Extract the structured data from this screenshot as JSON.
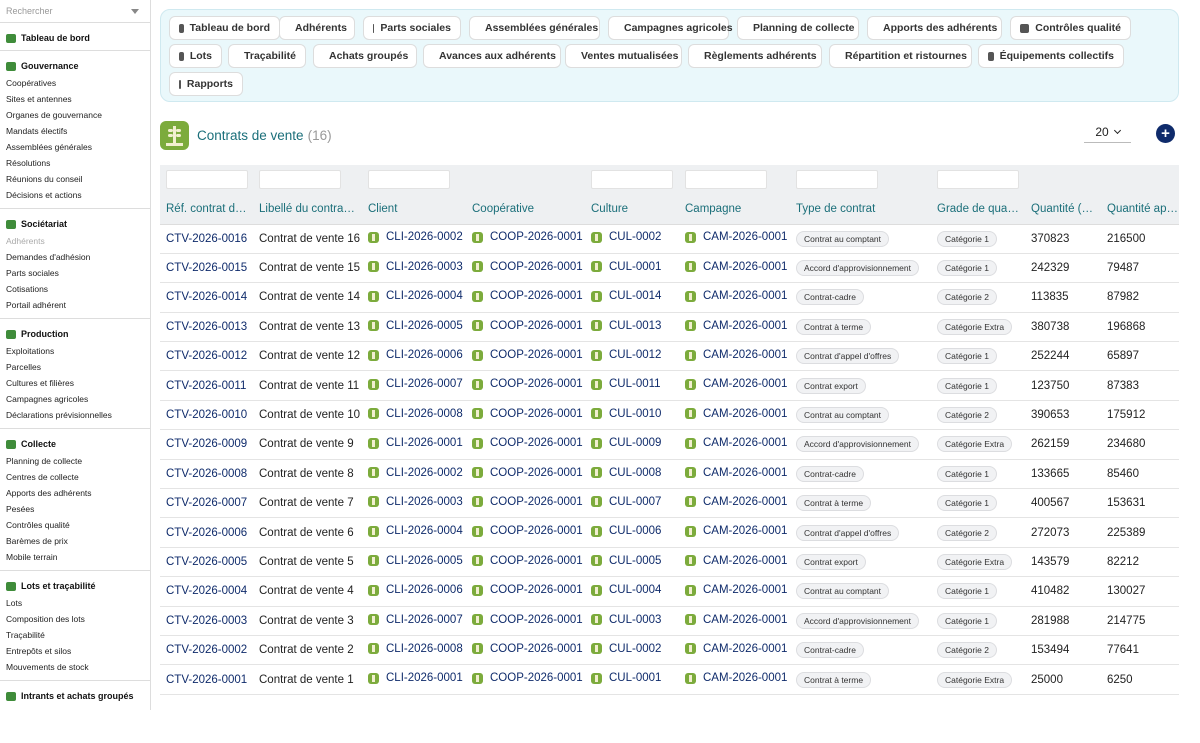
{
  "sidebar": {
    "search_placeholder": "Rechercher",
    "sections": [
      {
        "title": "Tableau de bord",
        "icon": "dashboard-icon",
        "items": []
      },
      {
        "title": "Gouvernance",
        "icon": "institution-icon",
        "items": [
          "Coopératives",
          "Sites et antennes",
          "Organes de gouvernance",
          "Mandats électifs",
          "Assemblées générales",
          "Résolutions",
          "Réunions du conseil",
          "Décisions et actions"
        ]
      },
      {
        "title": "Sociétariat",
        "icon": "users-icon",
        "items": [
          "Adhérents",
          "Demandes d'adhésion",
          "Parts sociales",
          "Cotisations",
          "Portail adhérent"
        ]
      },
      {
        "title": "Production",
        "icon": "tractor-icon",
        "items": [
          "Exploitations",
          "Parcelles",
          "Cultures et filières",
          "Campagnes agricoles",
          "Déclarations prévisionnelles"
        ]
      },
      {
        "title": "Collecte",
        "icon": "truck-icon",
        "items": [
          "Planning de collecte",
          "Centres de collecte",
          "Apports des adhérents",
          "Pesées",
          "Contrôles qualité",
          "Barèmes de prix",
          "Mobile terrain"
        ]
      },
      {
        "title": "Lots et traçabilité",
        "icon": "boxes-icon",
        "items": [
          "Lots",
          "Composition des lots",
          "Traçabilité",
          "Entrepôts et silos",
          "Mouvements de stock"
        ]
      },
      {
        "title": "Intrants et achats groupés",
        "icon": "cart-icon",
        "items": []
      }
    ]
  },
  "topnav": [
    {
      "label": "Tableau de bord",
      "icon": "dashboard-icon"
    },
    {
      "label": "Adhérents",
      "icon": "user-icon"
    },
    {
      "label": "Parts sociales",
      "icon": "ticket-icon"
    },
    {
      "label": "Assemblées générales",
      "icon": "users-icon"
    },
    {
      "label": "Campagnes agricoles",
      "icon": "calendar-icon"
    },
    {
      "label": "Planning de collecte",
      "icon": "route-icon"
    },
    {
      "label": "Apports des adhérents",
      "icon": "truck-icon"
    },
    {
      "label": "Contrôles qualité",
      "icon": "checklist-icon"
    },
    {
      "label": "Lots",
      "icon": "boxes-icon"
    },
    {
      "label": "Traçabilité",
      "icon": "barcode-icon"
    },
    {
      "label": "Achats groupés",
      "icon": "cart-icon"
    },
    {
      "label": "Avances aux adhérents",
      "icon": "seedling-icon"
    },
    {
      "label": "Ventes mutualisées",
      "icon": "dolly-icon"
    },
    {
      "label": "Règlements adhérents",
      "icon": "money-icon"
    },
    {
      "label": "Répartition et ristournes",
      "icon": "scale-icon"
    },
    {
      "label": "Équipements collectifs",
      "icon": "tools-icon"
    },
    {
      "label": "Rapports",
      "icon": "chart-pie-icon"
    }
  ],
  "header": {
    "title": "Contrats de vente",
    "count": "(16)",
    "page_size": "20"
  },
  "table": {
    "columns": [
      "Réf. contrat de vente",
      "Libellé du contrat de vente",
      "Client",
      "Coopérative",
      "Culture",
      "Campagne",
      "Type de contrat",
      "Grade de qualité",
      "Quantité (kg)",
      "Quantité appelée (kg)"
    ],
    "rows": [
      [
        "CTV-2026-0016",
        "Contrat de vente 16",
        "CLI-2026-0002",
        "COOP-2026-0001",
        "CUL-0002",
        "CAM-2026-0001",
        "Contrat au comptant",
        "Catégorie 1",
        "370823",
        "216500"
      ],
      [
        "CTV-2026-0015",
        "Contrat de vente 15",
        "CLI-2026-0003",
        "COOP-2026-0001",
        "CUL-0001",
        "CAM-2026-0001",
        "Accord d'approvisionnement",
        "Catégorie 1",
        "242329",
        "79487"
      ],
      [
        "CTV-2026-0014",
        "Contrat de vente 14",
        "CLI-2026-0004",
        "COOP-2026-0001",
        "CUL-0014",
        "CAM-2026-0001",
        "Contrat-cadre",
        "Catégorie 2",
        "113835",
        "87982"
      ],
      [
        "CTV-2026-0013",
        "Contrat de vente 13",
        "CLI-2026-0005",
        "COOP-2026-0001",
        "CUL-0013",
        "CAM-2026-0001",
        "Contrat à terme",
        "Catégorie Extra",
        "380738",
        "196868"
      ],
      [
        "CTV-2026-0012",
        "Contrat de vente 12",
        "CLI-2026-0006",
        "COOP-2026-0001",
        "CUL-0012",
        "CAM-2026-0001",
        "Contrat d'appel d'offres",
        "Catégorie 1",
        "252244",
        "65897"
      ],
      [
        "CTV-2026-0011",
        "Contrat de vente 11",
        "CLI-2026-0007",
        "COOP-2026-0001",
        "CUL-0011",
        "CAM-2026-0001",
        "Contrat export",
        "Catégorie 1",
        "123750",
        "87383"
      ],
      [
        "CTV-2026-0010",
        "Contrat de vente 10",
        "CLI-2026-0008",
        "COOP-2026-0001",
        "CUL-0010",
        "CAM-2026-0001",
        "Contrat au comptant",
        "Catégorie 2",
        "390653",
        "175912"
      ],
      [
        "CTV-2026-0009",
        "Contrat de vente 9",
        "CLI-2026-0001",
        "COOP-2026-0001",
        "CUL-0009",
        "CAM-2026-0001",
        "Accord d'approvisionnement",
        "Catégorie Extra",
        "262159",
        "234680"
      ],
      [
        "CTV-2026-0008",
        "Contrat de vente 8",
        "CLI-2026-0002",
        "COOP-2026-0001",
        "CUL-0008",
        "CAM-2026-0001",
        "Contrat-cadre",
        "Catégorie 1",
        "133665",
        "85460"
      ],
      [
        "CTV-2026-0007",
        "Contrat de vente 7",
        "CLI-2026-0003",
        "COOP-2026-0001",
        "CUL-0007",
        "CAM-2026-0001",
        "Contrat à terme",
        "Catégorie 1",
        "400567",
        "153631"
      ],
      [
        "CTV-2026-0006",
        "Contrat de vente 6",
        "CLI-2026-0004",
        "COOP-2026-0001",
        "CUL-0006",
        "CAM-2026-0001",
        "Contrat d'appel d'offres",
        "Catégorie 2",
        "272073",
        "225389"
      ],
      [
        "CTV-2026-0005",
        "Contrat de vente 5",
        "CLI-2026-0005",
        "COOP-2026-0001",
        "CUL-0005",
        "CAM-2026-0001",
        "Contrat export",
        "Catégorie Extra",
        "143579",
        "82212"
      ],
      [
        "CTV-2026-0004",
        "Contrat de vente 4",
        "CLI-2026-0006",
        "COOP-2026-0001",
        "CUL-0004",
        "CAM-2026-0001",
        "Contrat au comptant",
        "Catégorie 1",
        "410482",
        "130027"
      ],
      [
        "CTV-2026-0003",
        "Contrat de vente 3",
        "CLI-2026-0007",
        "COOP-2026-0001",
        "CUL-0003",
        "CAM-2026-0001",
        "Accord d'approvisionnement",
        "Catégorie 1",
        "281988",
        "214775"
      ],
      [
        "CTV-2026-0002",
        "Contrat de vente 2",
        "CLI-2026-0008",
        "COOP-2026-0001",
        "CUL-0002",
        "CAM-2026-0001",
        "Contrat-cadre",
        "Catégorie 2",
        "153494",
        "77641"
      ],
      [
        "CTV-2026-0001",
        "Contrat de vente 1",
        "CLI-2026-0001",
        "COOP-2026-0001",
        "CUL-0001",
        "CAM-2026-0001",
        "Contrat à terme",
        "Catégorie Extra",
        "25000",
        "6250"
      ]
    ]
  },
  "colors": {
    "accent": "#1b6f7a",
    "link": "#0f2b6b",
    "brand_green": "#7cab3c"
  }
}
